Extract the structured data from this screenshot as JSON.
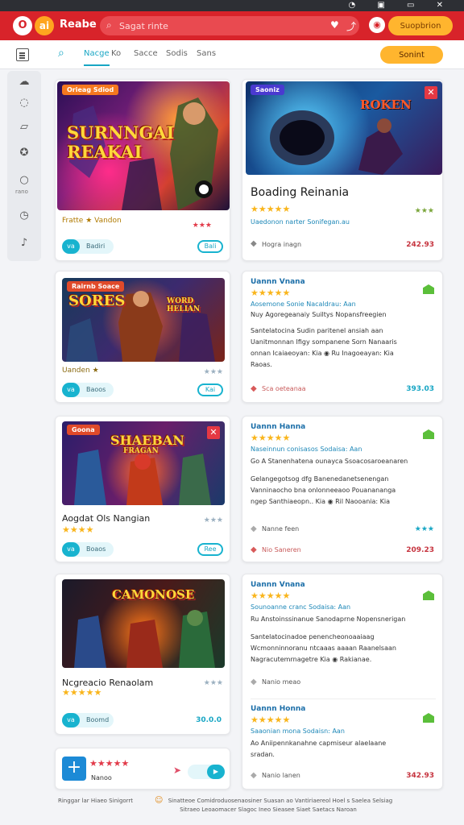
{
  "app": {
    "title": "Reabe",
    "logo_a": "O",
    "logo_b": "ai",
    "search_placeholder": "Sagat rinte",
    "account_icon": "user-circle-icon",
    "signin_label": "Suopbrion",
    "colors": {
      "brand": "#d8232a",
      "accent": "#ffb52e",
      "teal": "#18b3cf"
    }
  },
  "tabs": {
    "items": [
      "Nacge",
      "Ko",
      "Sacce",
      "Sodis",
      "Sans"
    ],
    "active_index": 0,
    "cta_label": "Sonint"
  },
  "sidebar": {
    "icons": [
      "cloud-icon",
      "chat-icon",
      "book-icon",
      "gamepad-icon",
      "circle-icon",
      "clock-icon",
      "music-icon"
    ],
    "label": "rano"
  },
  "cards_left": [
    {
      "tag": "Orieag Sdiod",
      "art_title": "SURNNGAI REAKAI",
      "meta": "Fratte ★ Vandon",
      "pill_short": "va",
      "pill_text": "Badiri",
      "btn": "Bali",
      "rating": "★★★"
    },
    {
      "tag": "Rairnb Soace",
      "art_title": "SORES",
      "art_sub": "WORD HELIAN",
      "meta": "Uanden ★",
      "pill_short": "va",
      "pill_text": "Baoos",
      "btn": "Kai",
      "rating": "★★★"
    },
    {
      "tag": "Goona",
      "art_title": "SHAEBAN",
      "art_sub": "FRAGAN",
      "name": "Aogdat Ols Nangian",
      "pill_short": "va",
      "pill_text": "Boaos",
      "btn": "Ree",
      "rating": "★★★"
    },
    {
      "art_title": "CAMONOSE",
      "name": "Ncgreacio Renaolam",
      "pill_short": "va",
      "pill_text": "Boomd",
      "price": "30.0.0",
      "rating": "★★★"
    }
  ],
  "bottom_card": {
    "stars": "★★★★★",
    "label": "Nanoo"
  },
  "cards_right": [
    {
      "tag": "Saoniz",
      "art_title": "ROKEN",
      "title": "Boading Reinania",
      "subtitle": "Uaedonon narter Sonifegan.au",
      "foot": "Hogra inagn",
      "price": "242.93",
      "rating": "★★★"
    },
    {
      "title": "Uannn Vnana",
      "subtitle": "Aosemone Sonie Nacaldrau: Aan",
      "l1": "Nuy Agoregeanaiy Suiltys Nopansfreegien",
      "l2": "Santelatocina Sudin paritenel ansiah aan",
      "l3": "Uanitmonnan Ifigy sompanene Sorn Nanaaris",
      "l4": "onnan Icaiaeoyan: Kia ◉ Ru Inagoeayan: Kia",
      "l5": "Raoas.",
      "foot": "Sca oeteanaa",
      "price": "393.03"
    },
    {
      "title": "Uannn Hanna",
      "subtitle": "Naseinnun conisasos Sodaisa: Aan",
      "l1": "Go A Stanenhatena ounayca Ssoacosaroeanaren",
      "l2": "Gelangegotsog dfg Banenedanetsenengan",
      "l3": "Vanninaocho bna onlonneeaoo Pouanananga",
      "l4": "ngep Santhiaeopn.. Kia ◉ Ril Naooania: Kia",
      "foot": "Nanne feen",
      "price": "209.23",
      "rating": "★★★",
      "foot2": "Nio Saneren"
    },
    {
      "title": "Uannn Vnana",
      "subtitle": "Sounoanne cranc Sodaisa: Aan",
      "l1": "Ru Anstoinssinanue Sanodaprne Nopensnerigan",
      "l2": "Santelatocinadoe penencheonoaaiaag",
      "l3": "Wcmonninnoranu  ntcaaas aaaan Raanelsaan",
      "l4": "Nagracutemrnagetre Kia ◉ Rakianae.",
      "foot": "Nanio meao"
    },
    {
      "title": "Uannn Honna",
      "subtitle": "Saaonian mona Sodaisn: Aan",
      "l1": "Ao Aniipennkanahne capmiseur alaelaane",
      "l2": "sradan.",
      "foot": "Nanio lanen",
      "price": "342.93"
    }
  ],
  "footer": {
    "left": "Ringgar lar Hiaeo Sinigorrt",
    "right": "Sinatteoe Comidroduosenaosiner Suasan ao Vantiriaereol Hoel s Saelea Selsiag",
    "sub": "Sitraeo Leoaomacer Slagoc Ineo Sieasee Siaet Saetacs Naroan"
  }
}
